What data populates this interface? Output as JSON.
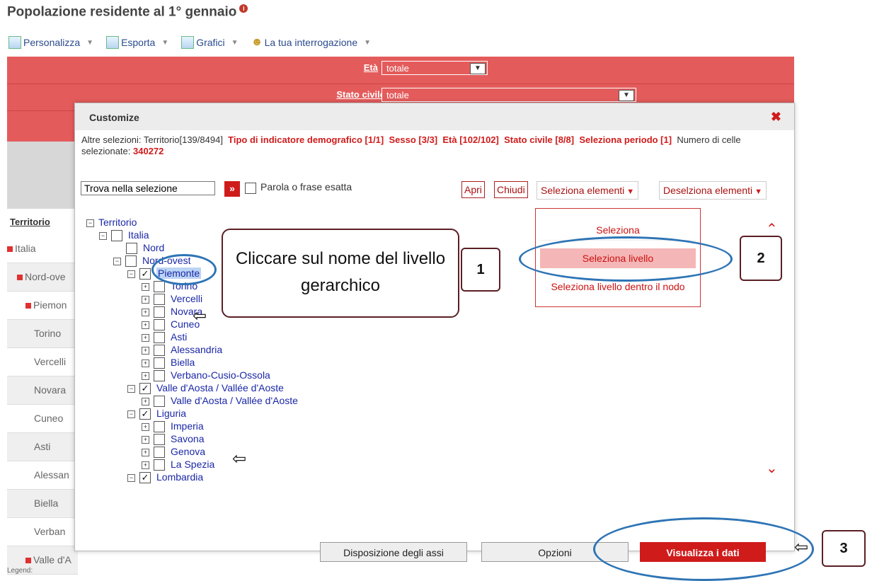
{
  "page": {
    "title": "Popolazione residente al 1° gennaio",
    "title_icon": "info-icon"
  },
  "toolbar": {
    "items": [
      {
        "label": "Personalizza",
        "icon": "customize-icon"
      },
      {
        "label": "Esporta",
        "icon": "export-icon"
      },
      {
        "label": "Grafici",
        "icon": "chart-icon"
      },
      {
        "label": "La tua interrogazione",
        "icon": "user-icon"
      }
    ]
  },
  "filters": [
    {
      "label": "Età",
      "value": "totale"
    },
    {
      "label": "Stato civile",
      "value": "totale"
    }
  ],
  "left_table": {
    "header": "Territorio",
    "rows": [
      "Italia",
      "Nord-ove",
      "Piemon",
      "Torino",
      "Vercelli",
      "Novara",
      "Cuneo",
      "Asti",
      "Alessan",
      "Biella",
      "Verban",
      "Valle d'A"
    ]
  },
  "legend": "Legend:",
  "modal": {
    "title": "Customize",
    "selection_prefix": "Altre selezioni: Territorio[139/8494]",
    "sel_indicatore": "Tipo di indicatore demografico [1/1]",
    "sel_sesso": "Sesso [3/3]",
    "sel_eta": "Età [102/102]",
    "sel_stato": "Stato civile [8/8]",
    "sel_periodo": "Seleziona periodo [1]",
    "cells_label": "Numero di celle selezionate:",
    "cells_value": "340272",
    "search_value": "Trova nella selezione",
    "search_go": "»",
    "exact_label": "Parola o frase esatta",
    "open_label": "Apri",
    "close_label": "Chiudi",
    "select_items_label": "Seleziona elementi",
    "deselect_items_label": "Deselziona elementi",
    "tree": {
      "root": "Territorio",
      "italia": "Italia",
      "nord": "Nord",
      "nordovest": "Nord-ovest",
      "piemonte": "Piemonte",
      "torino": "Torino",
      "vercelli": "Vercelli",
      "novara": "Novara",
      "cuneo": "Cuneo",
      "asti": "Asti",
      "alessandria": "Alessandria",
      "biella": "Biella",
      "vco": "Verbano-Cusio-Ossola",
      "valle": "Valle d'Aosta / Vallée d'Aoste",
      "valle2": "Valle d'Aosta / Vallée d'Aoste",
      "liguria": "Liguria",
      "imperia": "Imperia",
      "savona": "Savona",
      "genova": "Genova",
      "laspezia": "La Spezia",
      "lombardia": "Lombardia"
    },
    "menu": {
      "seleziona": "Seleziona",
      "seleziona_livello": "Seleziona livello",
      "seleziona_livello_nodo": "Seleziona livello dentro il nodo"
    },
    "footer": {
      "assi": "Disposizione degli assi",
      "opzioni": "Opzioni",
      "visualizza": "Visualizza i dati"
    }
  },
  "annotations": {
    "callout_text": "Cliccare sul nome del livello gerarchico",
    "n1": "1",
    "n2": "2",
    "n3": "3"
  }
}
